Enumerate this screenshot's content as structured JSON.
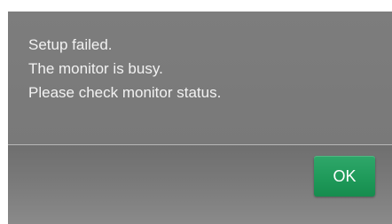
{
  "dialog": {
    "message_lines": [
      "Setup failed.",
      "The monitor is busy.",
      "Please check monitor status."
    ],
    "ok_label": "OK"
  },
  "colors": {
    "dialog_background": "#7a7a7a",
    "message_text": "#f2f2f2",
    "ok_button": "#1f9a5a",
    "ok_text": "#ffffff"
  }
}
